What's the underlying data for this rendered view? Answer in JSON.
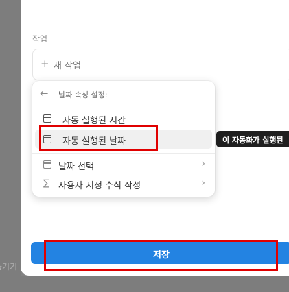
{
  "background": {
    "hint_text": "숨기기"
  },
  "section": {
    "label": "작업"
  },
  "task_input": {
    "plus": "+",
    "text": "새 작업"
  },
  "dropdown": {
    "back_icon": "←",
    "header": "날짜 속성 설정:",
    "items": [
      {
        "label": "자동 실행된 시간",
        "icon": "calendar-icon"
      },
      {
        "label": "자동 실행된 날짜",
        "icon": "calendar-icon"
      },
      {
        "label": "날짜 선택",
        "icon": "calendar-icon",
        "chevron": "›"
      },
      {
        "label": "사용자 지정 수식 작성",
        "icon": "sigma-icon",
        "sigma": "∑",
        "chevron": "›"
      }
    ]
  },
  "tooltip": {
    "text": "이 자동화가 실행된"
  },
  "footer": {
    "save_label": "저장"
  },
  "colors": {
    "accent": "#2383e2",
    "highlight_box": "#e00000",
    "tooltip_bg": "#1f1f1f"
  }
}
